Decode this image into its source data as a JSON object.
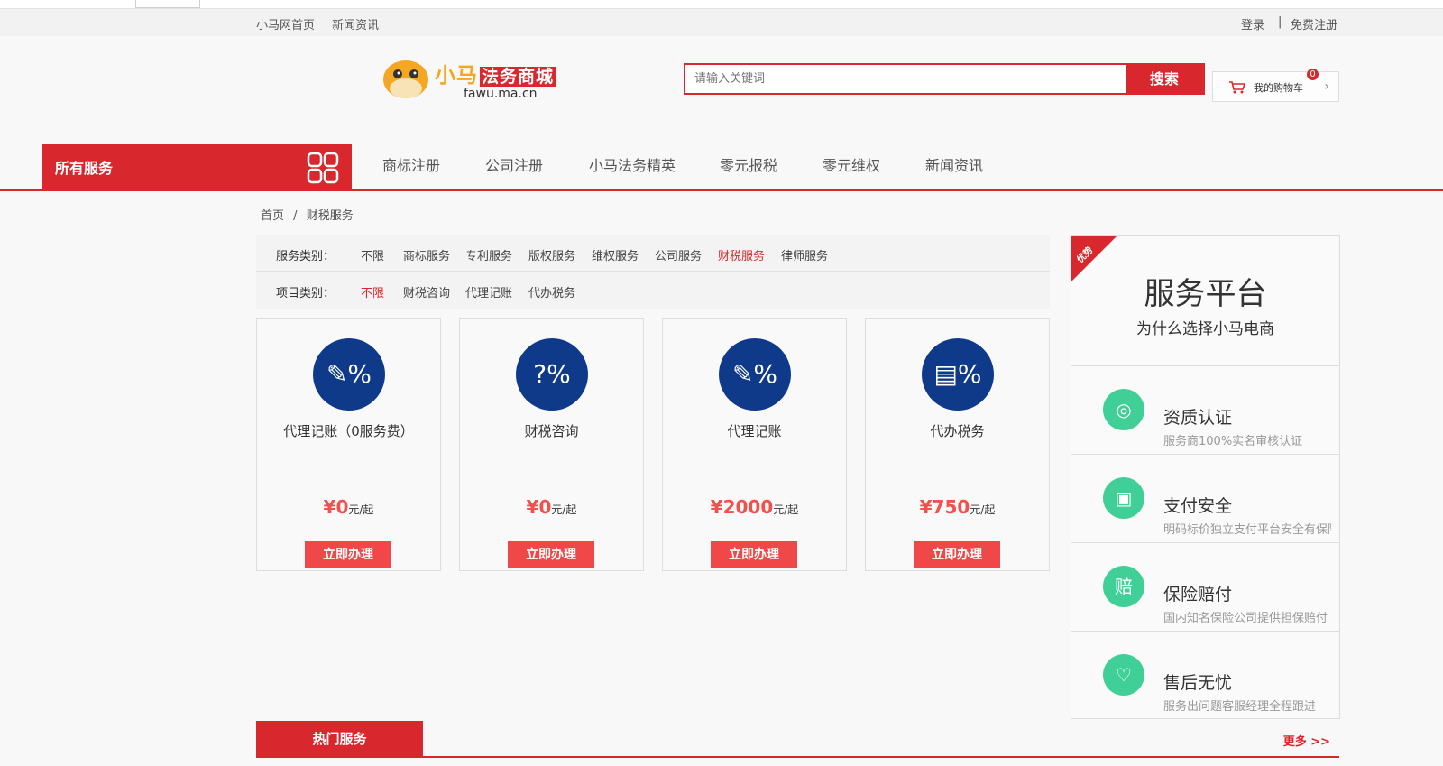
{
  "topbar": {
    "home_link": "小马网首页",
    "news_link": "新闻资讯",
    "login": "登录",
    "separator": "|",
    "register": "免费注册"
  },
  "logo": {
    "brand_yellow": "小马",
    "brand_red": "法务商城",
    "url": "fawu.ma.cn"
  },
  "search": {
    "placeholder": "请输入关键词",
    "button": "搜索"
  },
  "cart": {
    "label": "我的购物车",
    "count": "0"
  },
  "nav": {
    "all_services": "所有服务",
    "items": [
      "商标注册",
      "公司注册",
      "小马法务精英",
      "零元报税",
      "零元维权",
      "新闻资讯"
    ]
  },
  "breadcrumb": {
    "home": "首页",
    "sep": "/",
    "current": "财税服务"
  },
  "filter": {
    "service_label": "服务类别：",
    "service_options": [
      "不限",
      "商标服务",
      "专利服务",
      "版权服务",
      "维权服务",
      "公司服务",
      "财税服务",
      "律师服务"
    ],
    "service_active_index": 6,
    "project_label": "项目类别：",
    "project_options": [
      "不限",
      "财税咨询",
      "代理记账",
      "代办税务"
    ],
    "project_active_index": 0
  },
  "products": [
    {
      "icon": "pencil-percent-icon",
      "glyph": "✎%",
      "name": "代理记账（0服务费）",
      "price": "¥0",
      "unit": "元/起",
      "button": "立即办理"
    },
    {
      "icon": "question-percent-icon",
      "glyph": "?%",
      "name": "财税咨询",
      "price": "¥0",
      "unit": "元/起",
      "button": "立即办理"
    },
    {
      "icon": "pencil-percent-icon",
      "glyph": "✎%",
      "name": "代理记账",
      "price": "¥2000",
      "unit": "元/起",
      "button": "立即办理"
    },
    {
      "icon": "document-percent-icon",
      "glyph": "▤%",
      "name": "代办税务",
      "price": "¥750",
      "unit": "元/起",
      "button": "立即办理"
    }
  ],
  "side": {
    "ribbon": "优势",
    "title": "服务平台",
    "subtitle": "为什么选择小马电商",
    "features": [
      {
        "icon": "shield-search-icon",
        "glyph": "◎",
        "title": "资质认证",
        "desc": "服务商100%实名审核认证"
      },
      {
        "icon": "monitor-pulse-icon",
        "glyph": "▣",
        "title": "支付安全",
        "desc": "明码标价独立支付平台安全有保障"
      },
      {
        "icon": "compensation-icon",
        "glyph": "赔",
        "title": "保险赔付",
        "desc": "国内知名保险公司提供担保赔付"
      },
      {
        "icon": "heart-icon",
        "glyph": "♡",
        "title": "售后无忧",
        "desc": "服务出问题客服经理全程跟进"
      }
    ]
  },
  "hot": {
    "tab": "热门服务",
    "more": "更多 >>"
  },
  "colors": {
    "brand_red": "#d8282d",
    "navy": "#0f3a8a",
    "green": "#3fcf97",
    "price": "#f0504e"
  }
}
